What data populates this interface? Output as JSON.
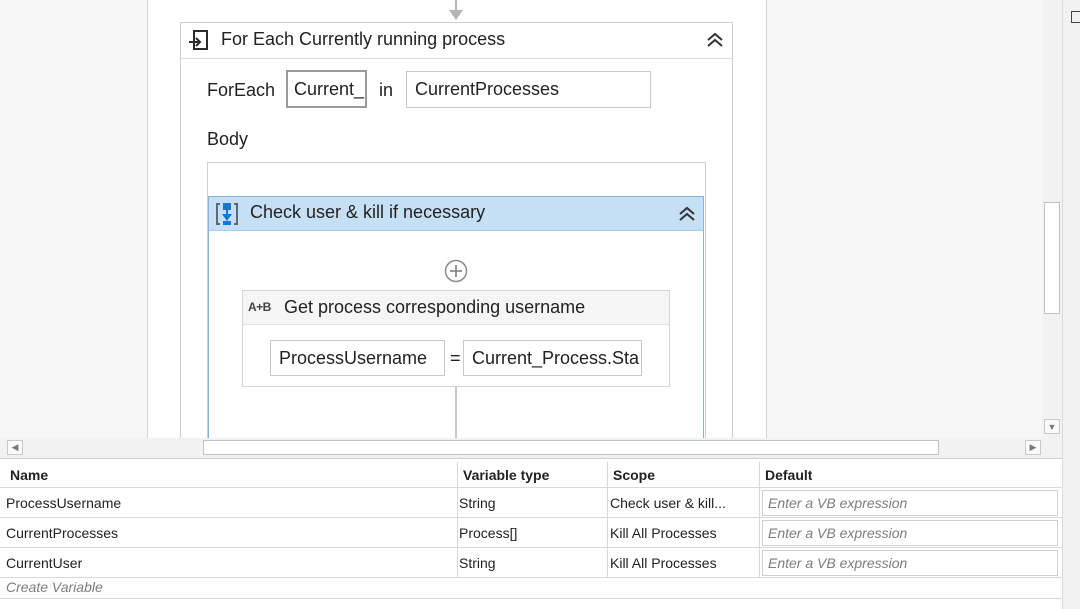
{
  "workflow": {
    "foreach_activity": {
      "title": "For Each Currently running process",
      "foreach_label": "ForEach",
      "item_variable": "Current_",
      "in_label": "in",
      "collection": "CurrentProcesses",
      "body_label": "Body"
    },
    "sequence_activity": {
      "title": "Check user & kill if necessary"
    },
    "assign_activity": {
      "title": "Get process corresponding username",
      "icon_text": "A+B",
      "to": "ProcessUsername",
      "operator": "=",
      "value": "Current_Process.Sta"
    }
  },
  "variables_panel": {
    "columns": [
      "Name",
      "Variable type",
      "Scope",
      "Default"
    ],
    "rows": [
      {
        "name": "ProcessUsername",
        "type": "String",
        "scope": "Check user & kill...",
        "default_placeholder": "Enter a VB expression"
      },
      {
        "name": "CurrentProcesses",
        "type": "Process[]",
        "scope": "Kill All Processes",
        "default_placeholder": "Enter a VB expression"
      },
      {
        "name": "CurrentUser",
        "type": "String",
        "scope": "Kill All Processes",
        "default_placeholder": "Enter a VB expression"
      }
    ],
    "create_variable_label": "Create Variable"
  },
  "colors": {
    "sequence_header": "#c5dff4",
    "selection_border": "#87b5e0",
    "icon_blue": "#1976d2"
  },
  "icons": {
    "foreach": "foreach-loop-icon",
    "sequence": "sequence-icon",
    "assign": "assign-icon",
    "collapse": "double-chevron-up-icon",
    "add": "plus-circle-icon"
  }
}
